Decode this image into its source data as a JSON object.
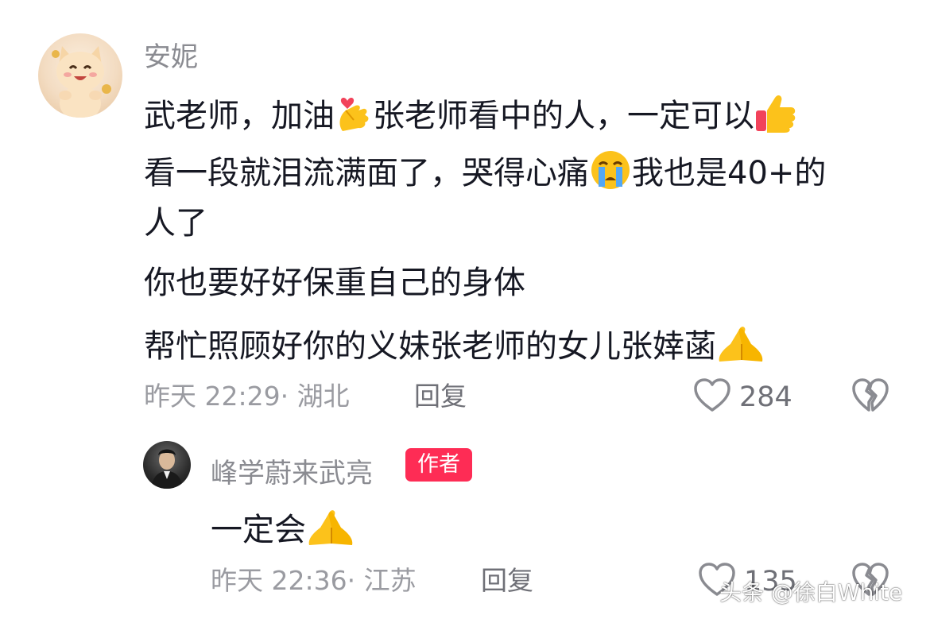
{
  "comment": {
    "username": "安妮",
    "line1_a": "武老师，加油",
    "line1_b": "张老师看中的人，一定可以",
    "line2_a": "看一段就泪流满面了，哭得心痛",
    "line2_b": "我也是40+的",
    "line3": "人了",
    "line4": "你也要好好保重自己的身体",
    "line5": "帮忙照顾好你的义妹张老师的女儿张婞菡",
    "time": "昨天 22:29",
    "location": "· 湖北",
    "reply_label": "回复",
    "like_count": "284",
    "emojis": [
      "finger-heart-emoji",
      "thumbs-up-emoji",
      "crying-face-emoji",
      "pray-emoji"
    ]
  },
  "reply": {
    "username": "峰学蔚来武亮",
    "badge": "作者",
    "text": "一定会",
    "time": "昨天 22:36",
    "location": "· 江苏",
    "reply_label": "回复",
    "like_count": "135"
  },
  "watermark": "头条 @徐白White",
  "colors": {
    "author_badge": "#fe2c55",
    "text_primary": "#161823",
    "text_secondary": "#8a8b91"
  }
}
